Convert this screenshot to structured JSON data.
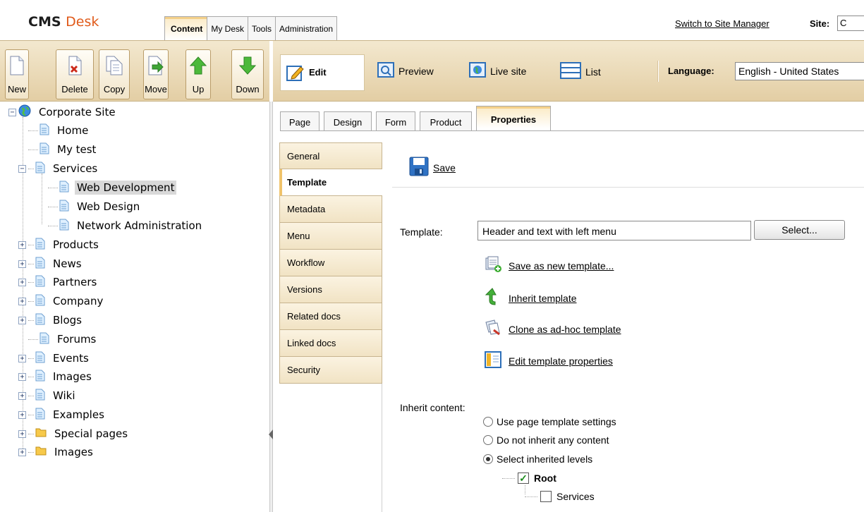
{
  "header": {
    "logo_part1": "CMS",
    "logo_part2": "Desk",
    "tabs": [
      {
        "label": "Content",
        "active": true
      },
      {
        "label": "My Desk",
        "active": false
      },
      {
        "label": "Tools",
        "active": false
      },
      {
        "label": "Administration",
        "active": false
      }
    ],
    "switch_link": "Switch to Site Manager",
    "site_label": "Site:",
    "site_value": "C"
  },
  "left_toolbar": {
    "buttons": [
      {
        "label": "New",
        "icon": "new-document-icon"
      },
      {
        "label": "Delete",
        "icon": "delete-document-icon"
      },
      {
        "label": "Copy",
        "icon": "copy-document-icon"
      },
      {
        "label": "Move",
        "icon": "move-document-icon"
      },
      {
        "label": "Up",
        "icon": "arrow-up-icon"
      },
      {
        "label": "Down",
        "icon": "arrow-down-icon"
      }
    ]
  },
  "right_toolbar": {
    "edit": "Edit",
    "preview": "Preview",
    "live_site": "Live site",
    "list": "List",
    "language_label": "Language:",
    "language_value": "English - United States"
  },
  "tree": {
    "nodes": [
      {
        "label": "Corporate Site"
      },
      {
        "label": "Home"
      },
      {
        "label": "My test"
      },
      {
        "label": "Services"
      },
      {
        "label": "Web Development",
        "selected": true
      },
      {
        "label": "Web Design"
      },
      {
        "label": "Network Administration"
      },
      {
        "label": "Products"
      },
      {
        "label": "News"
      },
      {
        "label": "Partners"
      },
      {
        "label": "Company"
      },
      {
        "label": "Blogs"
      },
      {
        "label": "Forums"
      },
      {
        "label": "Events"
      },
      {
        "label": "Images"
      },
      {
        "label": "Wiki"
      },
      {
        "label": "Examples"
      },
      {
        "label": "Special pages"
      },
      {
        "label": "Images"
      }
    ]
  },
  "page_tabs": [
    {
      "label": "Page"
    },
    {
      "label": "Design"
    },
    {
      "label": "Form"
    },
    {
      "label": "Product"
    },
    {
      "label": "Properties",
      "active": true
    }
  ],
  "side_tabs": [
    {
      "label": "General"
    },
    {
      "label": "Template",
      "active": true
    },
    {
      "label": "Metadata"
    },
    {
      "label": "Menu"
    },
    {
      "label": "Workflow"
    },
    {
      "label": "Versions"
    },
    {
      "label": "Related docs"
    },
    {
      "label": "Linked docs"
    },
    {
      "label": "Security"
    }
  ],
  "content": {
    "save": "Save",
    "template_label": "Template:",
    "template_value": "Header and text with left menu",
    "select_button": "Select...",
    "actions": [
      {
        "label": "Save as new template...",
        "icon": "save-template-icon"
      },
      {
        "label": "Inherit template",
        "icon": "inherit-icon"
      },
      {
        "label": "Clone as ad-hoc template",
        "icon": "clone-icon"
      },
      {
        "label": "Edit template properties",
        "icon": "template-properties-icon"
      }
    ],
    "inherit_label": "Inherit content:",
    "radios": [
      {
        "label": "Use page template settings",
        "checked": false
      },
      {
        "label": "Do not inherit any content",
        "checked": false
      },
      {
        "label": "Select inherited levels",
        "checked": true
      }
    ],
    "levels": [
      {
        "label": "Root",
        "checked": true
      },
      {
        "label": "Services",
        "checked": false
      }
    ]
  }
}
